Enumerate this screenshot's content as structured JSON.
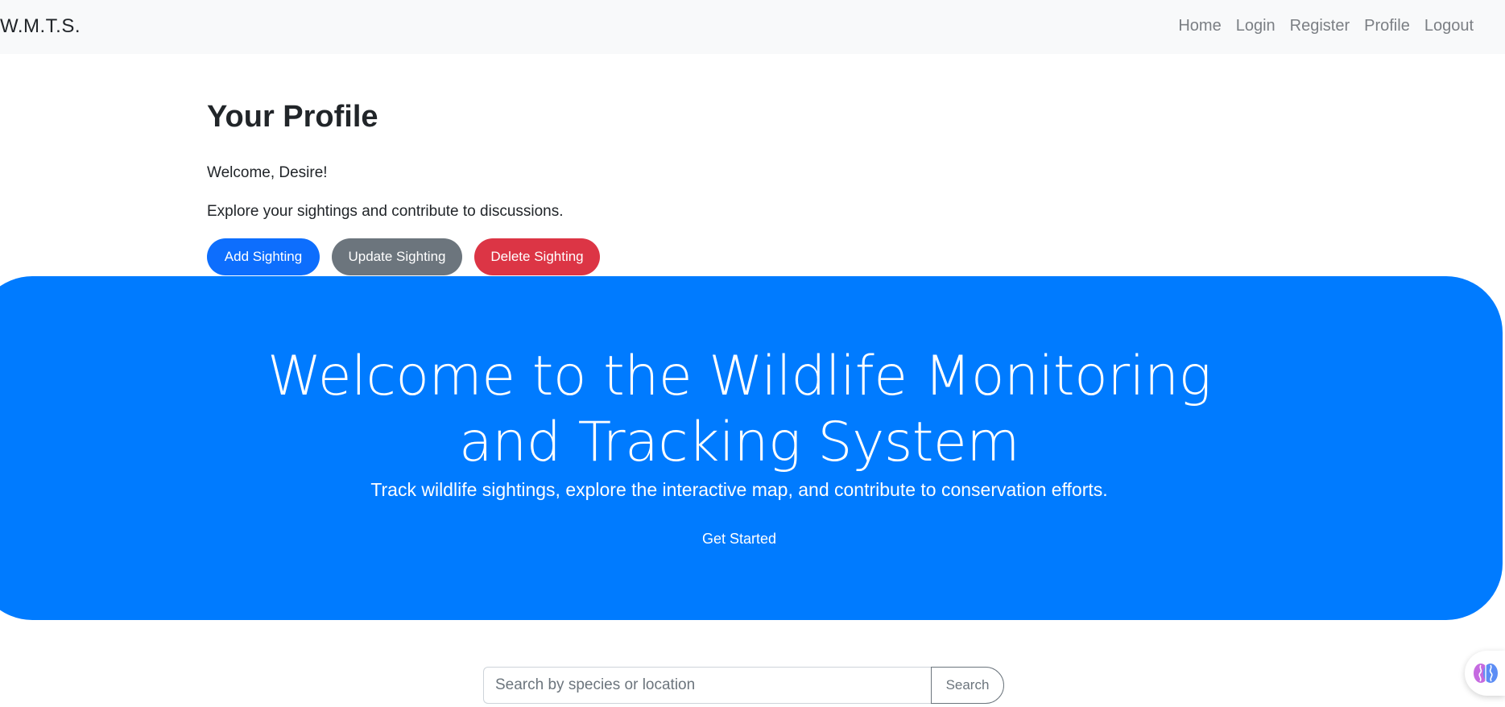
{
  "navbar": {
    "brand": "W.M.T.S.",
    "links": [
      "Home",
      "Login",
      "Register",
      "Profile",
      "Logout"
    ]
  },
  "profile": {
    "title": "Your Profile",
    "welcome": "Welcome, Desire!",
    "description": "Explore your sightings and contribute to discussions.",
    "buttons": {
      "add": "Add Sighting",
      "update": "Update Sighting",
      "delete": "Delete Sighting"
    }
  },
  "hero": {
    "title": "Welcome to the Wildlife Monitoring and Tracking System",
    "subtitle": "Track wildlife sightings, explore the interactive map, and contribute to conservation efforts.",
    "cta": "Get Started"
  },
  "search": {
    "placeholder": "Search by species or location",
    "value": "",
    "button": "Search"
  },
  "colors": {
    "primary": "#0d6efd",
    "hero": "#007bff",
    "secondary": "#6c757d",
    "danger": "#dc3545",
    "navbar_bg": "#f8f9fa"
  },
  "icons": {
    "floating_widget": "brain-icon"
  }
}
